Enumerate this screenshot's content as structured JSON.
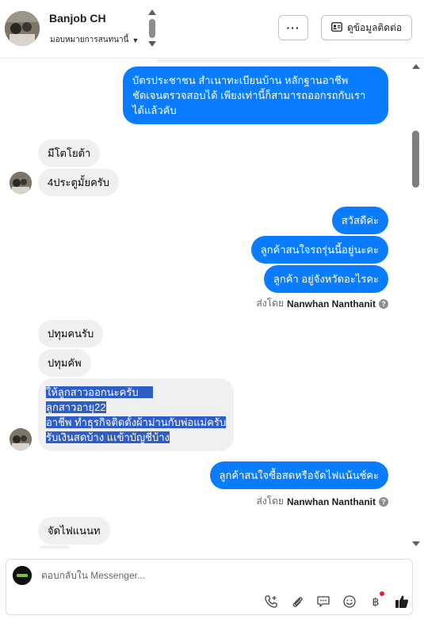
{
  "header": {
    "contact_name": "Banjob CH",
    "assign_label": "มอบหมายการสนทนานี้",
    "more_label": "···",
    "info_button_label": "ดูข้อมูลติดต่อ"
  },
  "messages": [
    {
      "id": "m1",
      "dir": "out",
      "text": "บัตรประชาชน สำเนาทะเบียนบ้าน หลักฐานอาชีพ\nชัดเจนตรวจสอบได้ เพียงเท่านี้ก็สามารถออกรถกับเรา\nได้แล้วคับ"
    },
    {
      "id": "m2",
      "dir": "in",
      "text": "มีโตโยต้า"
    },
    {
      "id": "m3",
      "dir": "in",
      "text": "4ประตูมั้ยครับ"
    },
    {
      "id": "m4",
      "dir": "out",
      "text": "สวัสดีค่ะ"
    },
    {
      "id": "m5",
      "dir": "out",
      "text": "ลูกค้าสนใจรถรุ่นนี้อยู่นะคะ"
    },
    {
      "id": "m6",
      "dir": "out",
      "text": "ลูกค้า อยู่จังหวัดอะไรคะ"
    },
    {
      "id": "m7",
      "dir": "in",
      "text": "ปทุมคนรับ"
    },
    {
      "id": "m8",
      "dir": "in",
      "text": "ปทุมคัพ"
    },
    {
      "id": "m9",
      "dir": "in",
      "lines": [
        "ให้ลูกสาวออกนะครับ",
        "ลูกสาวอายุ22",
        "อาชีพ ทำธุรกิจติดตั้งผ้าม่านกับพ่อแม่ครับ",
        "รับเงินสดบ้าง แเข้าบัญชีบ้าง"
      ]
    },
    {
      "id": "m10",
      "dir": "out",
      "text": "ลูกค้าสนใจซื้อสดหรือจัดไฟแน้นช์คะ"
    },
    {
      "id": "m11",
      "dir": "in",
      "text": "จัดไฟแนนท"
    }
  ],
  "sent_by": {
    "prefix": "ส่งโดย",
    "name": "Nanwhan Nanthanit",
    "help_glyph": "?"
  },
  "composer": {
    "placeholder": "ตอบกลับใน Messenger..."
  },
  "icons": [
    "avatar",
    "chevron-up-icon",
    "chevron-down-icon",
    "contact-card-icon",
    "phone-add-icon",
    "paperclip-icon",
    "speech-bubble-icon",
    "emoji-icon",
    "baht-icon",
    "thumbs-up-icon"
  ],
  "colors": {
    "outgoing_bubble": "#0a7cff",
    "incoming_bubble": "#f0f0f0",
    "selection": "#2f5dc7"
  }
}
